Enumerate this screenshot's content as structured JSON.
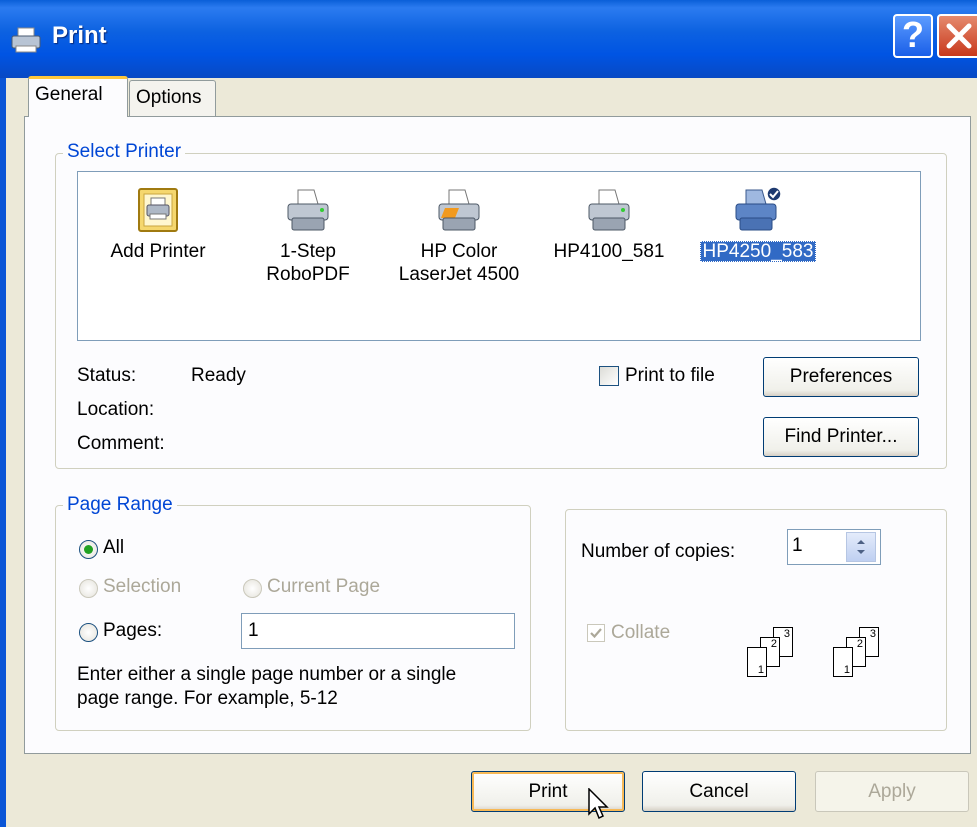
{
  "window": {
    "title": "Print",
    "help_glyph": "?"
  },
  "tabs": [
    {
      "label": "General"
    },
    {
      "label": "Options"
    }
  ],
  "select_printer": {
    "legend": "Select Printer",
    "printers": [
      {
        "line1": "Add Printer",
        "line2": "",
        "icon": "add-printer-icon"
      },
      {
        "line1": "1-Step",
        "line2": "RoboPDF",
        "icon": "printer-icon"
      },
      {
        "line1": "HP Color",
        "line2": "LaserJet 4500",
        "icon": "color-printer-icon"
      },
      {
        "line1": "HP4100_581",
        "line2": "",
        "icon": "printer-icon"
      },
      {
        "line1": "HP4250_583",
        "line2": "",
        "icon": "default-printer-icon",
        "selected": true
      }
    ],
    "status_label": "Status:",
    "status_value": "Ready",
    "location_label": "Location:",
    "location_value": "",
    "comment_label": "Comment:",
    "comment_value": "",
    "print_to_file_label": "Print to file",
    "print_to_file_checked": false,
    "preferences_label": "Preferences",
    "find_printer_label": "Find Printer..."
  },
  "page_range": {
    "legend": "Page Range",
    "all_label": "All",
    "selection_label": "Selection",
    "current_page_label": "Current Page",
    "pages_label": "Pages:",
    "pages_value": "1",
    "selected_option": "All",
    "hint_line1": "Enter either a single page number or a single",
    "hint_line2": "page range.  For example, 5-12"
  },
  "copies": {
    "label": "Number of copies:",
    "value": "1",
    "collate_label": "Collate",
    "collate_checked": true,
    "collate_pages": [
      "1",
      "2",
      "3"
    ]
  },
  "buttons": {
    "print": "Print",
    "cancel": "Cancel",
    "apply": "Apply"
  },
  "colors": {
    "titlebar": "#0054E3",
    "selection": "#316AC5",
    "legend": "#0046D5",
    "dialog_bg": "#ECE9D8"
  }
}
